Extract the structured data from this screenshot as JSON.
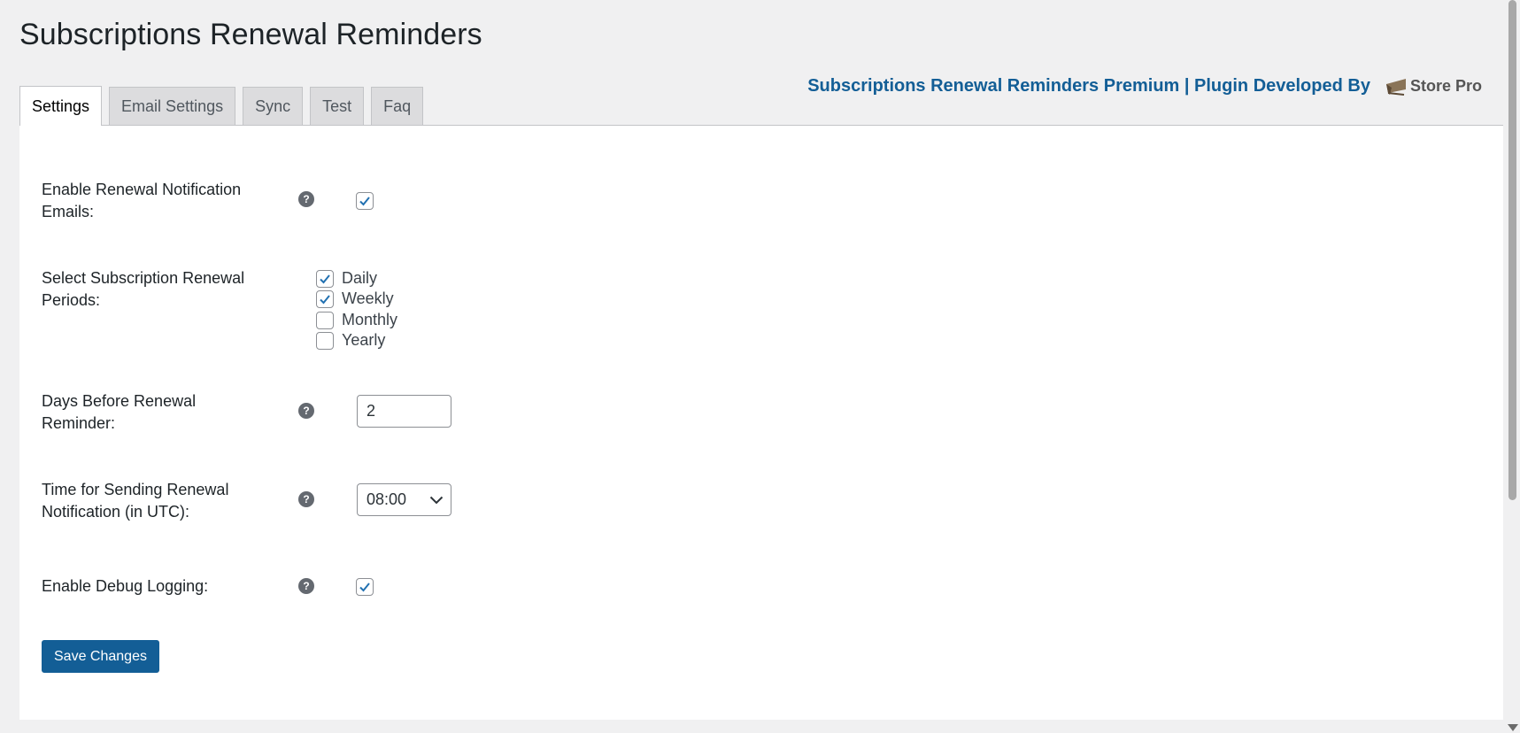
{
  "page": {
    "title": "Subscriptions Renewal Reminders"
  },
  "tabs": [
    {
      "label": "Settings",
      "active": true
    },
    {
      "label": "Email Settings",
      "active": false
    },
    {
      "label": "Sync",
      "active": false
    },
    {
      "label": "Test",
      "active": false
    },
    {
      "label": "Faq",
      "active": false
    }
  ],
  "brand": {
    "text": "Subscriptions Renewal Reminders Premium | Plugin Developed By",
    "logo_text": "Store Pro",
    "color": "#135e96"
  },
  "settings": {
    "enable_notifications": {
      "label": "Enable Renewal Notification Emails:",
      "checked": true
    },
    "renewal_periods": {
      "label": "Select Subscription Renewal Periods:",
      "options": [
        {
          "label": "Daily",
          "checked": true
        },
        {
          "label": "Weekly",
          "checked": true
        },
        {
          "label": "Monthly",
          "checked": false
        },
        {
          "label": "Yearly",
          "checked": false
        }
      ]
    },
    "days_before": {
      "label": "Days Before Renewal Reminder:",
      "value": "2"
    },
    "send_time": {
      "label": "Time for Sending Renewal Notification (in UTC):",
      "value": "08:00"
    },
    "debug_logging": {
      "label": "Enable Debug Logging:",
      "checked": true
    },
    "help_icon_glyph": "?"
  },
  "actions": {
    "save_label": "Save Changes",
    "button_color": "#135e96"
  },
  "icons": {
    "help": "question-circle-icon",
    "check": "checkmark-icon",
    "select": "chevron-down-icon"
  }
}
